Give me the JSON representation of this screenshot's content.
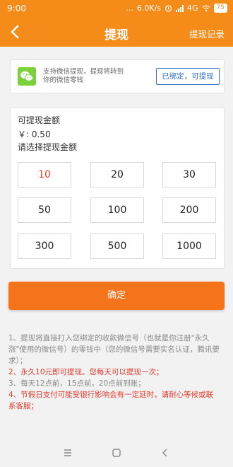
{
  "status_bar": {
    "time": "9:00",
    "dots": "...",
    "network_speed": "6.0K/s",
    "network_type": "4G",
    "battery": "75"
  },
  "header": {
    "title": "提现",
    "record_link": "提现记录",
    "bg_color": "#f58c1a"
  },
  "wechat": {
    "desc": "支持微信提现，提现将转到你的微信零钱",
    "bind_button": "已绑定，可提现"
  },
  "amount": {
    "available_label": "可提现金额",
    "balance": "￥: 0.50",
    "select_label": "请选择提现金额",
    "options": [
      "10",
      "20",
      "30",
      "50",
      "100",
      "200",
      "300",
      "500",
      "1000"
    ],
    "selected": "10"
  },
  "confirm_button": "确定",
  "notes": {
    "n1": "1、提现将直接打入您绑定的收款微信号（也就是你注册\"永久涨\"使用的微信号）的零钱中（您的微信号需要实名认证，腾讯要求）；",
    "n2": "2、永久10元即可提现。您每天可以提现一次；",
    "n3": "3、每天12点前，15点前，20点前到账；",
    "n4": "4、节假日支付可能受银行影响会有一定延时，请耐心等候或联系客服；"
  },
  "colors": {
    "accent": "#f5731b",
    "warning_text": "#e23b2d",
    "link_blue": "#2f6fc9",
    "wechat_green": "#7bd13c"
  }
}
